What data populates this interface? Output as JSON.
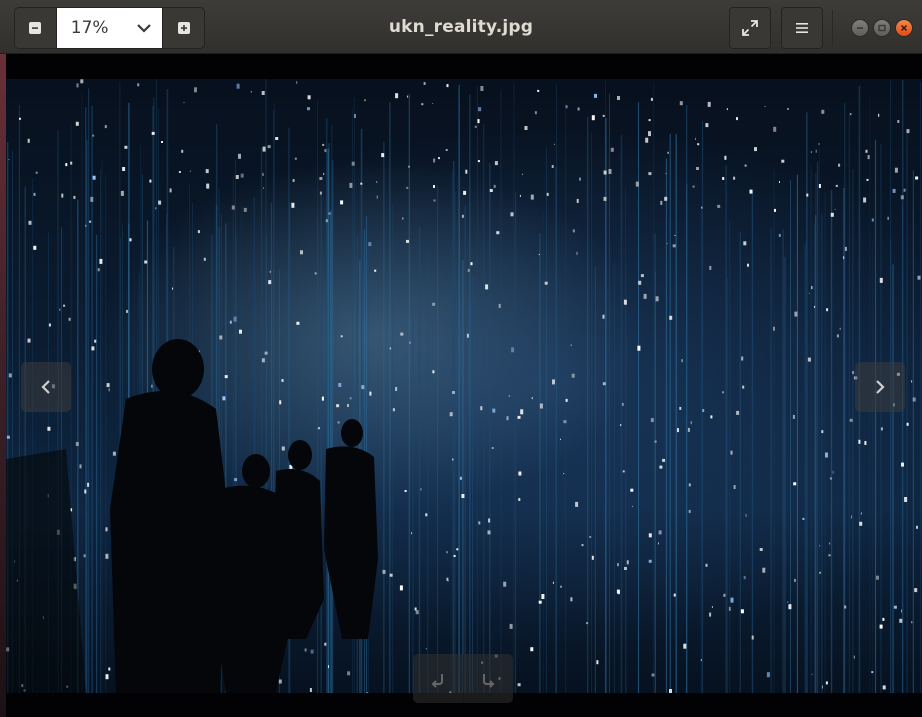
{
  "window": {
    "title": "ukn_reality.jpg"
  },
  "zoom": {
    "value": "17%"
  },
  "icons": {
    "zoom_out": "minus-icon",
    "zoom_in": "plus-icon",
    "dropdown": "chevron-down-icon",
    "fullscreen": "fullscreen-icon",
    "menu": "hamburger-menu-icon",
    "minimize": "minimize-icon",
    "maximize": "maximize-icon",
    "close": "close-icon",
    "previous": "chevron-left-icon",
    "next": "chevron-right-icon",
    "rotate_left": "rotate-left-icon",
    "rotate_right": "rotate-right-icon"
  },
  "colors": {
    "header": "#393834",
    "close_button": "#e95420",
    "photo_tint": "#0b1d33"
  }
}
